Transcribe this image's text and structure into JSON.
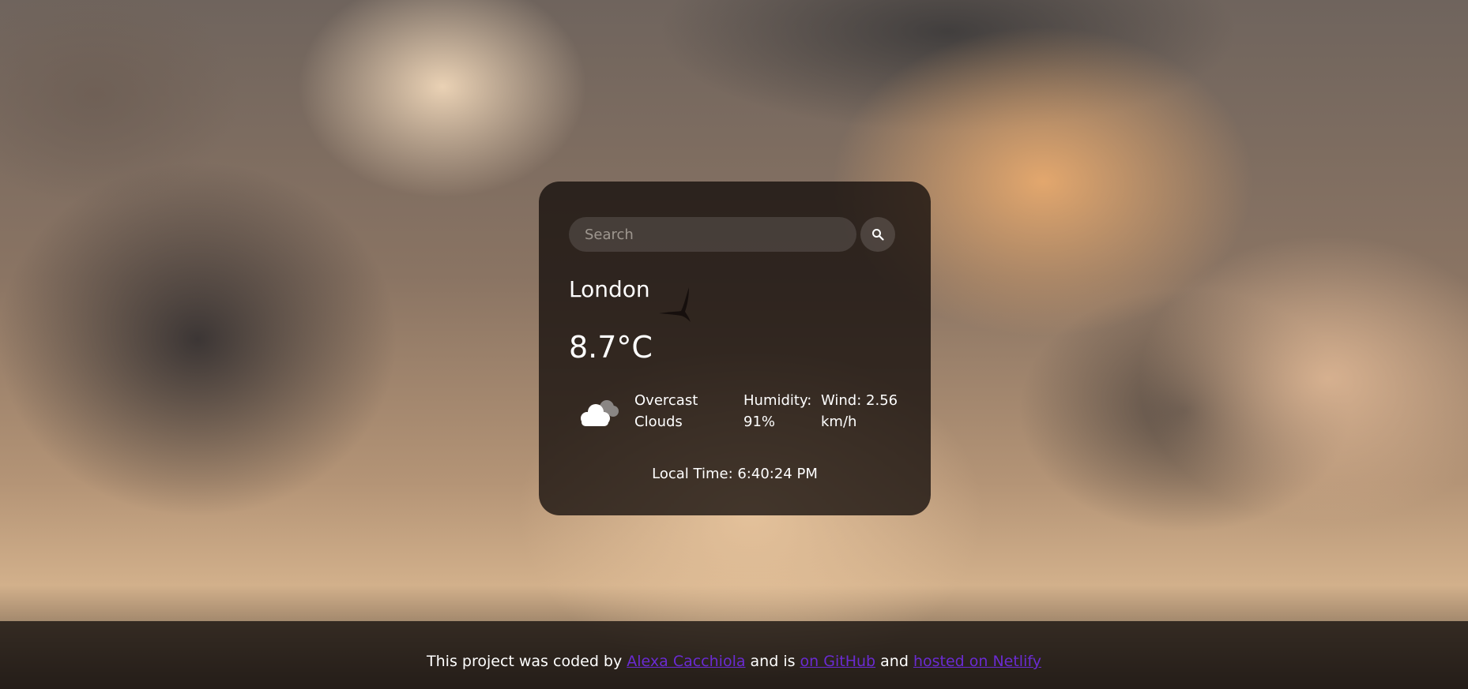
{
  "search": {
    "placeholder": "Search"
  },
  "weather": {
    "city": "London",
    "temperature": "8.7°C",
    "description": "Overcast Clouds",
    "humidity": "Humidity: 91%",
    "wind": "Wind: 2.56 km/h",
    "local_time": "Local Time: 6:40:24 PM",
    "icon": "overcast-clouds-icon"
  },
  "footer": {
    "text_1": "This project was coded by ",
    "author_link": "Alexa Cacchiola",
    "text_2": " and is ",
    "github_link": "on GitHub",
    "text_3": " and ",
    "netlify_link": "hosted on Netlify"
  },
  "colors": {
    "card_background": "#140e0c",
    "link": "#6a2bd1",
    "text": "#ffffff"
  }
}
